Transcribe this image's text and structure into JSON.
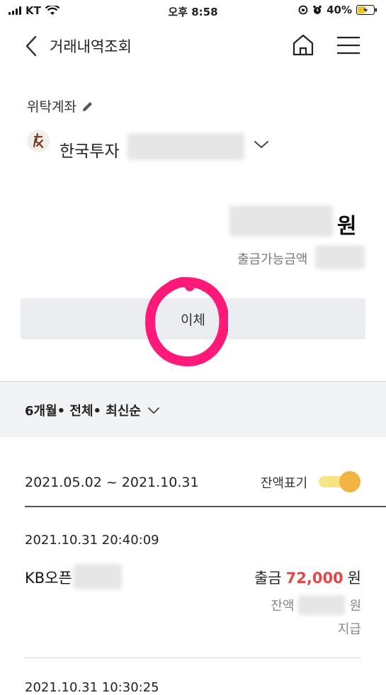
{
  "status_bar": {
    "carrier": "KT",
    "time": "오후 8:58",
    "battery": "40%"
  },
  "header": {
    "title": "거래내역조회"
  },
  "account": {
    "label": "위탁계좌",
    "bank_name": "한국투자"
  },
  "balance": {
    "unit": "원",
    "available_label": "출금가능금액"
  },
  "transfer_button": {
    "label": "이체"
  },
  "filter": {
    "label": "6개월• 전체• 최신순"
  },
  "period": {
    "range": "2021.05.02 ~ 2021.10.31",
    "balance_toggle_label": "잔액표기",
    "balance_toggle_on": true
  },
  "transactions": [
    {
      "datetime": "2021.10.31 20:40:09",
      "name": "KB오픈",
      "direction": "출금",
      "amount": "72,000",
      "unit": "원",
      "balance_label": "잔액",
      "balance_unit": "원",
      "type": "지급"
    },
    {
      "datetime": "2021.10.31 10:30:25"
    }
  ],
  "colors": {
    "accent_amount": "#e04848",
    "toggle_on": "#f2b544",
    "annotation_circle": "#ff1a7a"
  }
}
